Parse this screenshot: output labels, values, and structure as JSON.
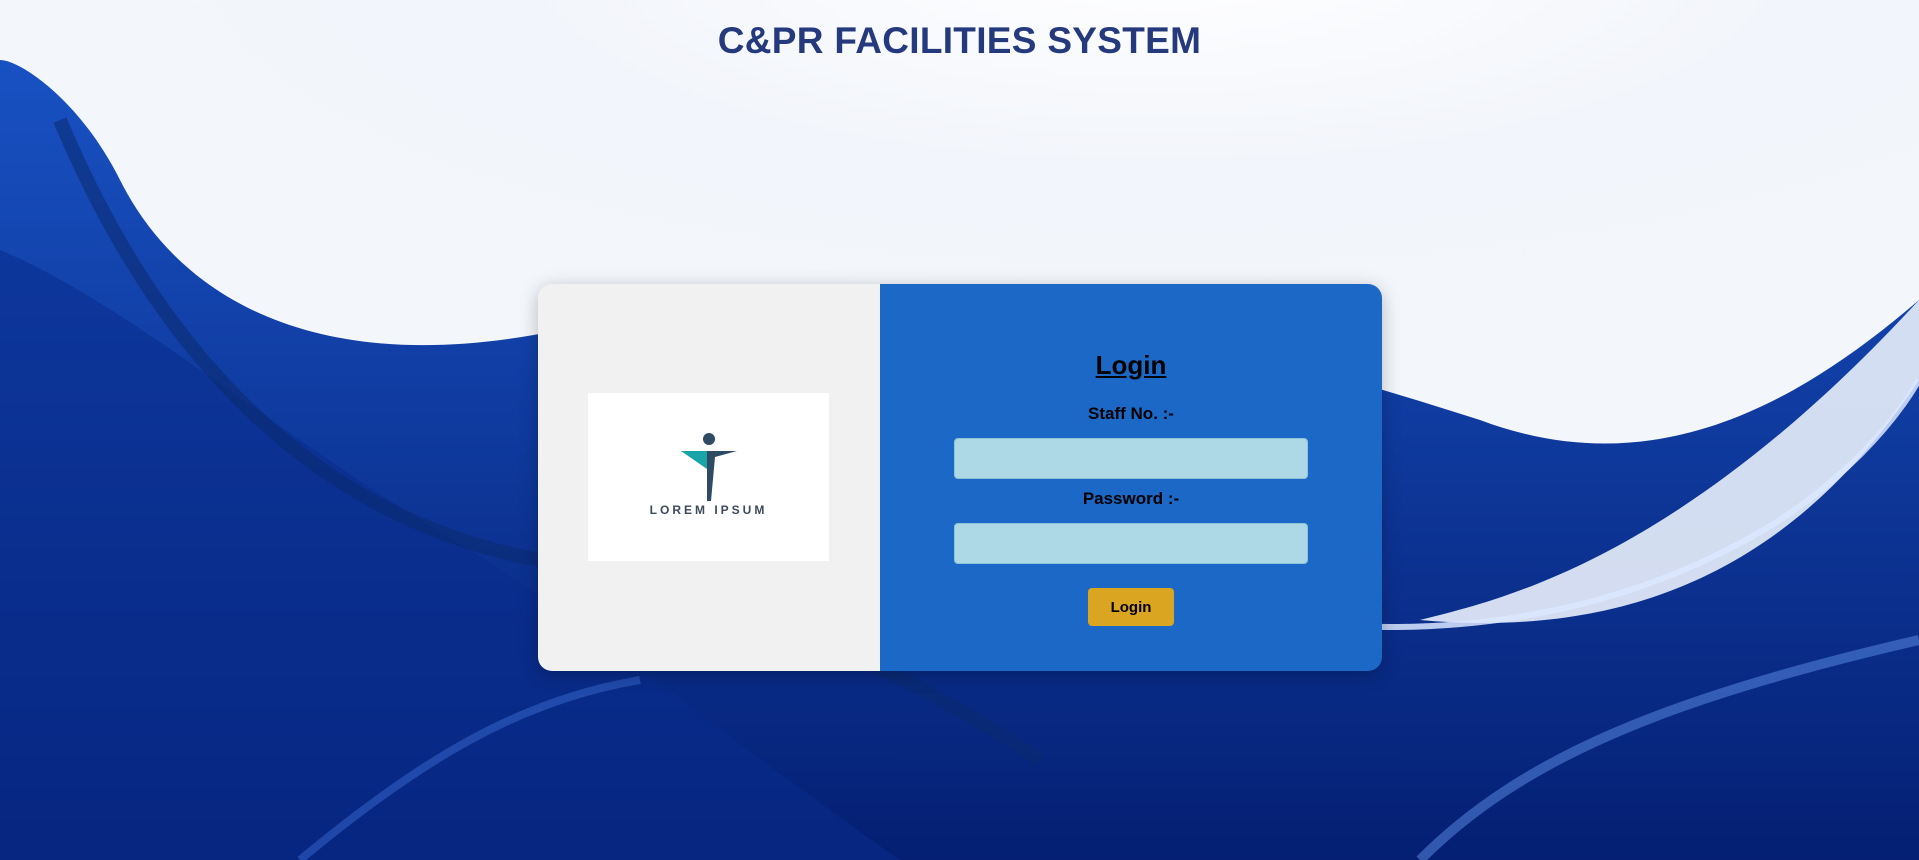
{
  "header": {
    "title": "C&PR FACILITIES SYSTEM"
  },
  "brand": {
    "logo_text": "LOREM IPSUM",
    "logo_icon": "person-figure-icon",
    "logo_colors": {
      "figure_dark": "#2f4a63",
      "figure_teal": "#19a4a8"
    }
  },
  "login_form": {
    "heading": "Login",
    "staff_label": "Staff No. :-",
    "staff_value": "",
    "password_label": "Password :-",
    "password_value": "",
    "submit_label": "Login"
  },
  "colors": {
    "title": "#253a7d",
    "panel_left": "#f1f1f1",
    "panel_right": "#1c68c7",
    "input_bg": "#add8e6",
    "button_bg": "#daa520"
  }
}
